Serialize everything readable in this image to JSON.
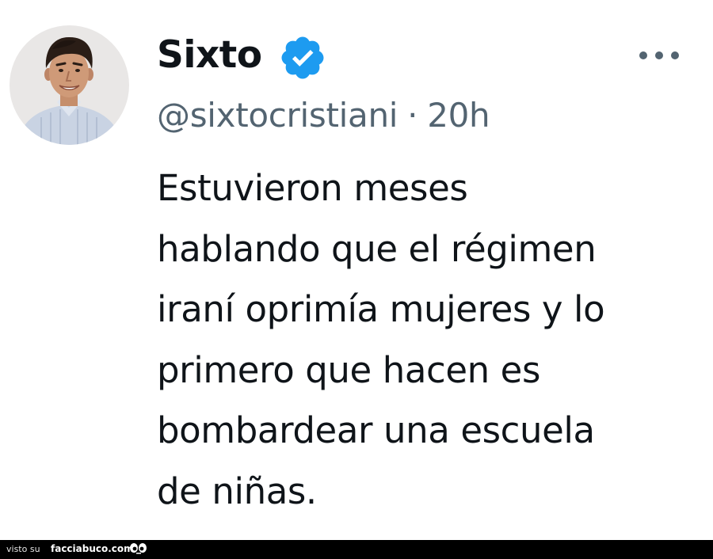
{
  "tweet": {
    "display_name": "Sixto",
    "handle": "@sixtocristiani",
    "separator": "·",
    "time": "20h",
    "verified_icon": "verified-badge-icon",
    "more_icon": "more-options-icon",
    "text_lines": [
      "Estuvieron meses",
      "hablando que el régimen",
      "iraní oprimía mujeres y lo",
      "primero que hacen es",
      "bombardear una escuela",
      "de niñas."
    ]
  },
  "footer": {
    "visto_label": "visto su",
    "site_label": "facciabuco.com",
    "logo_icon": "googly-eyes-icon"
  },
  "colors": {
    "verified": "#1d9bf0",
    "text": "#0f1419",
    "secondary": "#536471",
    "footer_bg": "#000000"
  }
}
